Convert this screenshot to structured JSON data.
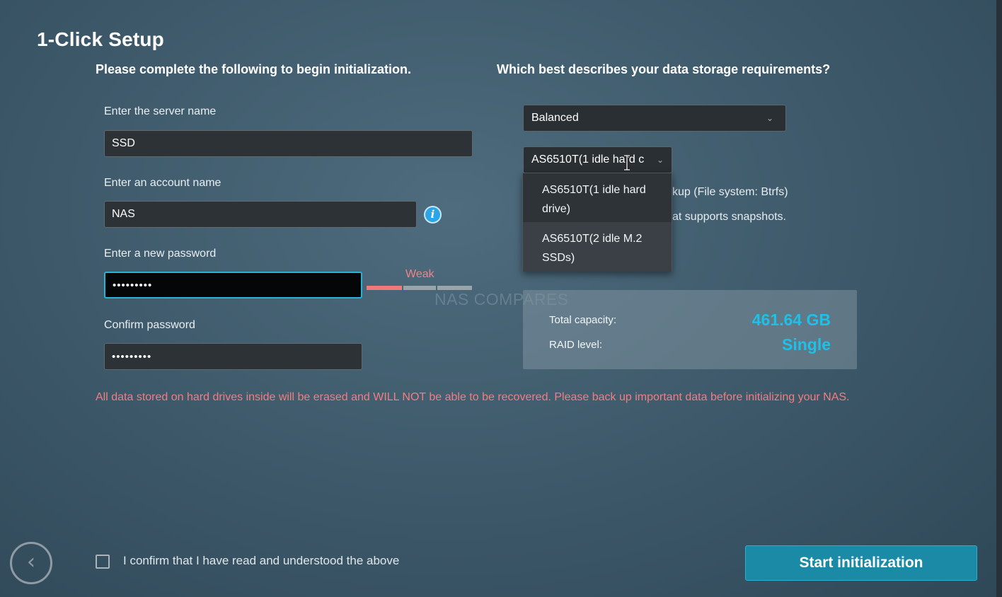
{
  "page": {
    "title": "1-Click Setup"
  },
  "left_section": {
    "heading": "Please complete the following to begin initialization.",
    "server_name": {
      "label": "Enter the server name",
      "value": "SSD"
    },
    "account_name": {
      "label": "Enter an account name",
      "value": "NAS",
      "icon": "info-icon"
    },
    "new_password": {
      "label": "Enter a new password",
      "value": "•••••••••",
      "strength_label": "Weak",
      "strength_level": 1,
      "strength_segments": 3
    },
    "confirm_password": {
      "label": "Confirm password",
      "value": "•••••••••"
    }
  },
  "right_section": {
    "heading": "Which best describes your data storage requirements?",
    "requirement_select": {
      "value": "Balanced"
    },
    "model_select": {
      "value": "AS6510T(1 idle hard c",
      "options": [
        {
          "line1": "AS6510T(1 idle hard",
          "line2": "drive)"
        },
        {
          "line1": "AS6510T(2 idle M.2",
          "line2": "SSDs)"
        }
      ]
    },
    "partial_text_1": "kup (File system: Btrfs)",
    "partial_text_2": "at supports snapshots.",
    "summary": {
      "total_capacity_label": "Total capacity:",
      "total_capacity_value": "461.64 GB",
      "raid_level_label": "RAID level:",
      "raid_level_value": "Single"
    }
  },
  "watermark": "NAS COMPARES",
  "warning": "All data stored on hard drives inside will be erased and WILL NOT be able to be recovered. Please back up important data before initializing your NAS.",
  "footer": {
    "confirm_label": "I confirm that I have read and understood the above",
    "confirm_checked": false,
    "start_button": "Start initialization",
    "back_icon": "chevron-left-icon"
  },
  "colors": {
    "accent": "#27b3d6",
    "capacity": "#1fc0e8",
    "warning": "#f07e82",
    "strength_weak": "#f07a7a"
  }
}
